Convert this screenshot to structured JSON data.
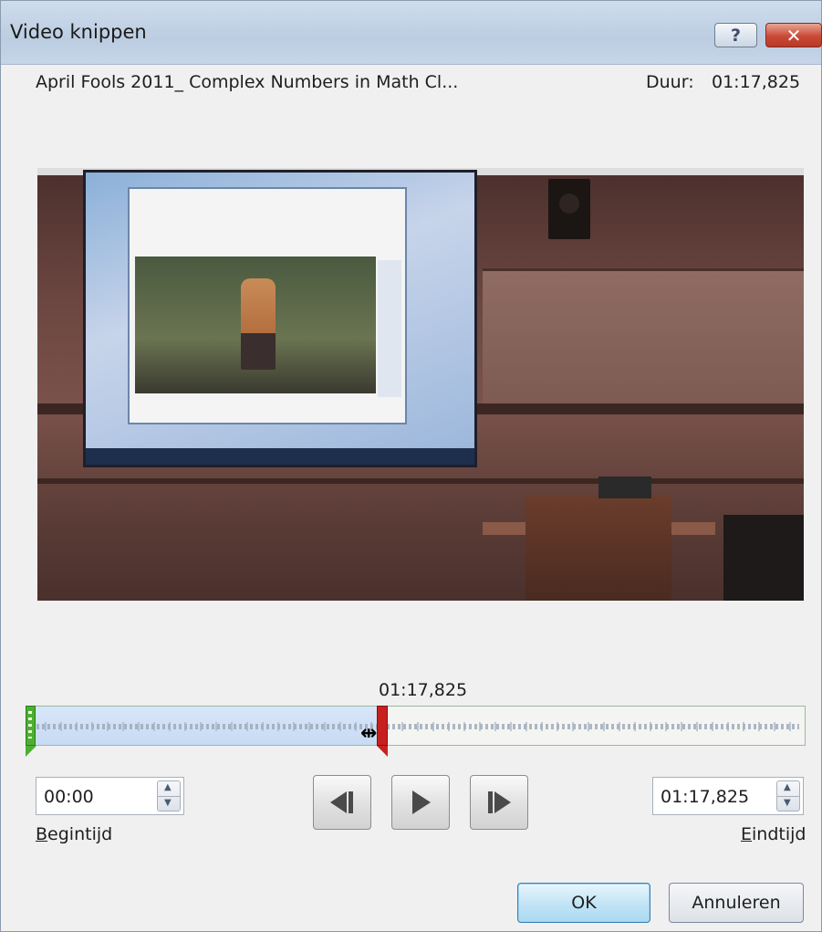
{
  "window": {
    "title": "Video knippen",
    "help_label": "?",
    "close_label": "✕"
  },
  "header": {
    "file_name": "April Fools 2011_ Complex Numbers in Math Cl...",
    "duration_label": "Duur:",
    "duration_value": "01:17,825"
  },
  "timeline": {
    "current_time": "01:17,825",
    "selected_fraction": 0.45
  },
  "start_time": {
    "value": "00:00",
    "label_hotkey": "B",
    "label_rest": "egintijd"
  },
  "end_time": {
    "value": "01:17,825",
    "label_hotkey": "E",
    "label_rest": "indtijd"
  },
  "transport": {
    "previous_frame_icon": "previous-frame-icon",
    "play_icon": "play-icon",
    "next_frame_icon": "next-frame-icon"
  },
  "buttons": {
    "ok": "OK",
    "cancel": "Annuleren"
  },
  "colors": {
    "start_handle": "#4caf32",
    "end_handle": "#c8201e",
    "selection": "#c7dbf4"
  }
}
